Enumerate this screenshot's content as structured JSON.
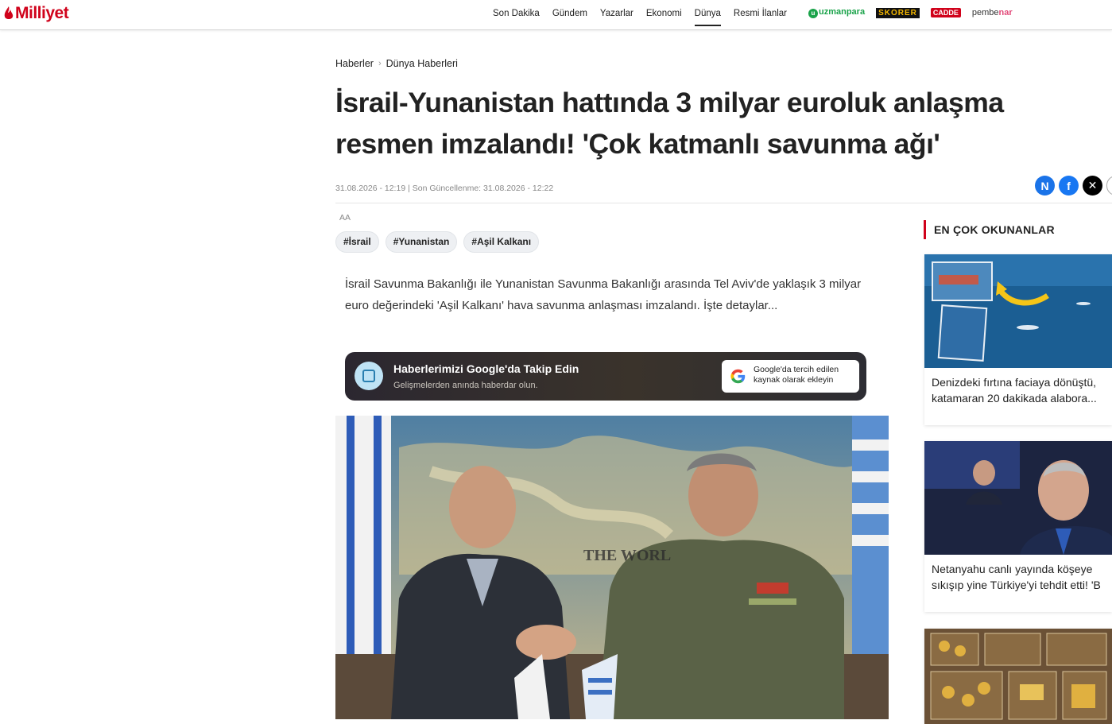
{
  "header": {
    "logo": "Milliyet",
    "nav": [
      "Son Dakika",
      "Gündem",
      "Yazarlar",
      "Ekonomi",
      "Dünya",
      "Resmi İlanlar"
    ],
    "active_nav": "Dünya",
    "partners": {
      "uzmanpara": "uzmanpara",
      "skorer": "SKORER",
      "cadde": "CADDE",
      "pembenar_a": "pembe",
      "pembenar_b": "nar"
    }
  },
  "breadcrumb": [
    "Haberler",
    "Dünya Haberleri"
  ],
  "article": {
    "title": "İsrail-Yunanistan hattında 3 milyar euroluk anlaşma resmen imzalandı! 'Çok katmanlı savunma ağı'",
    "meta": "31.08.2026 - 12:19 | Son Güncellenme: 31.08.2026 - 12:22",
    "font_toggle": "AA",
    "tags": [
      "#İsrail",
      "#Yunanistan",
      "#Aşil Kalkanı"
    ],
    "summary": "İsrail Savunma Bakanlığı ile Yunanistan Savunma Bakanlığı arasında Tel Aviv'de yaklaşık 3 milyar euro değerindeki 'Aşil Kalkanı' hava savunma anlaşması imzalandı. İşte detaylar..."
  },
  "google_follow": {
    "title": "Haberlerimizi Google'da Takip Edin",
    "subtitle": "Gelişmelerden anında haberdar olun.",
    "button": "Google'da tercih edilen kaynak olarak ekleyin"
  },
  "sidebar": {
    "title": "EN ÇOK OKUNANLAR",
    "items": [
      {
        "caption": "Denizdeki fırtına faciaya dönüştü, katamaran 20 dakikada alabora..."
      },
      {
        "caption": "Netanyahu canlı yayında köşeye sıkışıp yine Türkiye'yi tehdit etti! 'B"
      },
      {
        "caption": ""
      }
    ]
  },
  "colors": {
    "brand": "#d0021b",
    "text": "#222222"
  }
}
